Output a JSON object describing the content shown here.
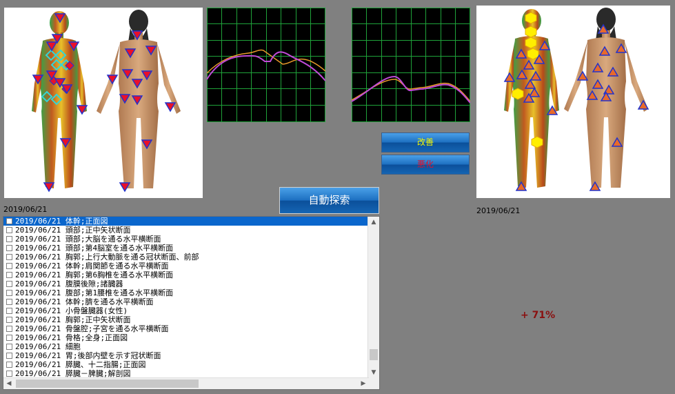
{
  "left_panel": {
    "date": "2019/06/21"
  },
  "right_panel": {
    "date": "2019/06/21"
  },
  "buttons": {
    "improve": {
      "label": "改善",
      "color": "#f4f400"
    },
    "worsen": {
      "label": "悪化",
      "color": "#e0102a"
    },
    "auto_search": {
      "label": "自動探索"
    }
  },
  "change_percent": "+ 71%",
  "list": {
    "rows": [
      "2019/06/21  体幹;正面図",
      "2019/06/21  頭部;正中矢状断面",
      "2019/06/21  頭部;大脳を通る水平横断面",
      "2019/06/21  頭部;第4脳室を通る水平横断面",
      "2019/06/21  胸郭;上行大動脈を通る冠状断面、前部",
      "2019/06/21  体幹;肩関節を通る水平横断面",
      "2019/06/21  胸郭;第6胸椎を通る水平横断面",
      "2019/06/21  腹膜後隙;諸臓器",
      "2019/06/21  腹部;第1腰椎を通る水平横断面",
      "2019/06/21  体幹;臍を通る水平横断面",
      "2019/06/21  小骨盤臓器(女性)",
      "2019/06/21  胸郭;正中矢状断面",
      "2019/06/21  骨盤腔;子宮を通る水平横断面",
      "2019/06/21  骨格;全身;正面図",
      "2019/06/21  細胞",
      "2019/06/21  胃;後部内壁を示す冠状断面",
      "2019/06/21  膵臓、十二指腸;正面図",
      "2019/06/21  膵臓－脾臓;解剖図"
    ],
    "selected_index": 0
  },
  "colors": {
    "grid": "#1fa33a",
    "series_a": "#c04ad8",
    "series_b": "#e89a2a",
    "marker_red": "#e8102a",
    "marker_blue": "#2233cc",
    "marker_cyan": "#33d6d6",
    "marker_yellow": "#ffee00",
    "marker_orange": "#e86a2a"
  }
}
